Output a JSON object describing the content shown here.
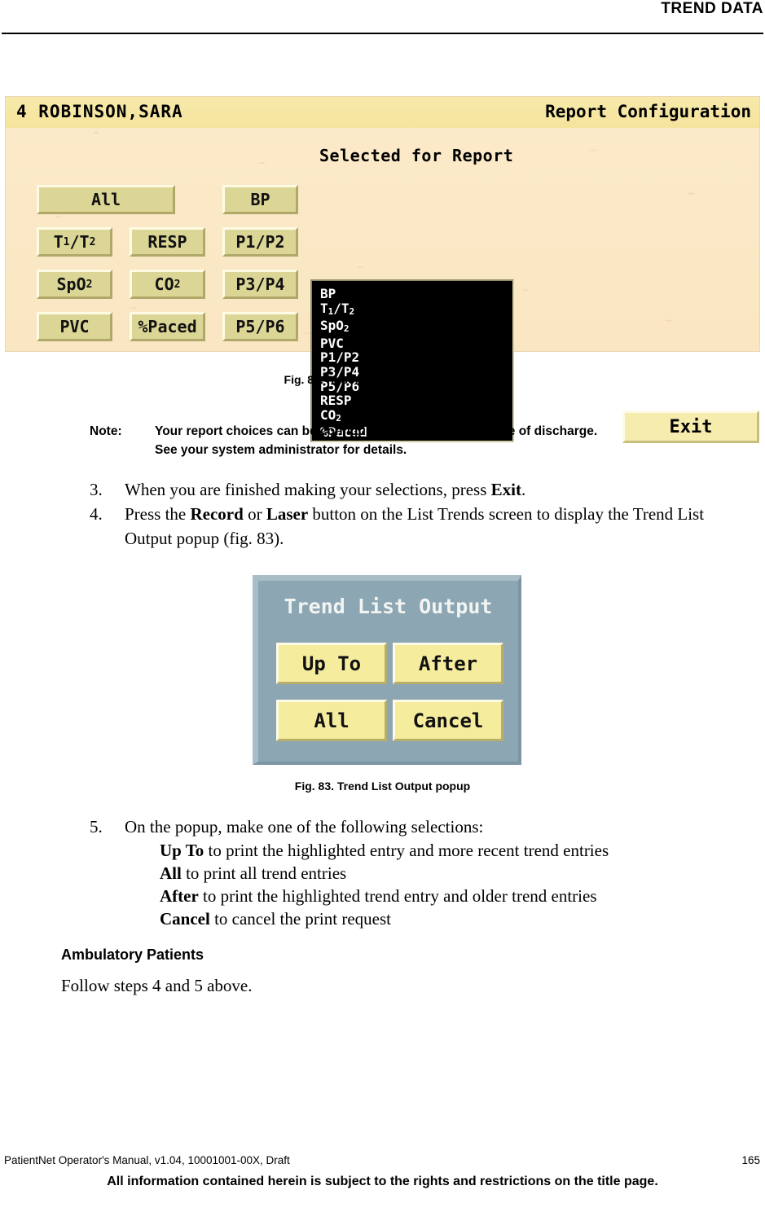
{
  "header": {
    "running_title": "TREND DATA"
  },
  "figure_82": {
    "caption": "Fig. 82. Report Configuration screen",
    "titlebar": {
      "bed_number": "4",
      "patient_name": "ROBINSON,SARA",
      "left_text": "4  ROBINSON,SARA",
      "screen_title": "Report Configuration"
    },
    "selected_label": "Selected for Report",
    "buttons": [
      {
        "label": "All",
        "sub": ""
      },
      {
        "label": "BP",
        "sub": ""
      },
      {
        "label": "T",
        "sub": "1/T2",
        "display": "T1/T2"
      },
      {
        "label": "RESP",
        "sub": ""
      },
      {
        "label": "P1/P2",
        "sub": ""
      },
      {
        "label": "SpO",
        "sub": "2",
        "display": "SpO2"
      },
      {
        "label": "CO",
        "sub": "2",
        "display": "CO2"
      },
      {
        "label": "P3/P4",
        "sub": ""
      },
      {
        "label": "PVC",
        "sub": ""
      },
      {
        "label": "%Paced",
        "sub": ""
      },
      {
        "label": "P5/P6",
        "sub": ""
      }
    ],
    "button_labels": {
      "all": "All",
      "bp": "BP",
      "t1t2_main": "T",
      "t1t2_sub1": "1",
      "t1t2_mid": "/T",
      "t1t2_sub2": "2",
      "resp": "RESP",
      "p1p2": "P1/P2",
      "spo2_main": "SpO",
      "spo2_sub": "2",
      "co2_main": "CO",
      "co2_sub": "2",
      "p3p4": "P3/P4",
      "pvc": "PVC",
      "paced": "%Paced",
      "p5p6": "P5/P6"
    },
    "selected_list": [
      "BP",
      "T1/T2",
      "SpO2",
      "PVC",
      "P1/P2",
      "P3/P4",
      "P5/P6",
      "RESP",
      "CO2",
      "%Paced"
    ],
    "selected_list_parts": [
      {
        "main": "BP",
        "sub": "",
        "tail": ""
      },
      {
        "main": "T",
        "sub": "1",
        "tail": "/T",
        "sub2": "2"
      },
      {
        "main": "SpO",
        "sub": "2",
        "tail": ""
      },
      {
        "main": "PVC",
        "sub": "",
        "tail": ""
      },
      {
        "main": "P1/P2",
        "sub": "",
        "tail": ""
      },
      {
        "main": "P3/P4",
        "sub": "",
        "tail": ""
      },
      {
        "main": "P5/P6",
        "sub": "",
        "tail": ""
      },
      {
        "main": "RESP",
        "sub": "",
        "tail": ""
      },
      {
        "main": "CO",
        "sub": "2",
        "tail": ""
      },
      {
        "main": "%Paced",
        "sub": "",
        "tail": ""
      }
    ],
    "exit_label": "Exit",
    "colors": {
      "background": "#fbe9c6",
      "titlebar": "#f5e49c",
      "button_face": "#dcd696",
      "exit_face": "#f6ecae",
      "listbox": "#000000",
      "listbox_text": "#ffffff"
    }
  },
  "note": {
    "label": "Note:",
    "line1": "Your report choices can be configured to be kept at the time of discharge.",
    "line2": "See your system administrator for details."
  },
  "steps": {
    "step3": {
      "number": "3.",
      "text_before": "When you are finished making your selections, press ",
      "bold1": "Exit",
      "text_after": "."
    },
    "step4": {
      "number": "4.",
      "text_before": "Press the ",
      "bold1": "Record",
      "text_mid": " or ",
      "bold2": "Laser",
      "text_after": " button on the List Trends screen to display the Trend List Output popup (fig. 83)."
    },
    "step5": {
      "number": "5.",
      "text": "On the popup, make one of the following selections:",
      "options": [
        {
          "bold": "Up To",
          "text": " to print the highlighted entry and more recent trend entries"
        },
        {
          "bold": "All",
          "text": " to print all trend entries"
        },
        {
          "bold": "After",
          "text": " to print the highlighted trend entry and older trend entries"
        },
        {
          "bold": "Cancel",
          "text": " to cancel the print request"
        }
      ]
    }
  },
  "figure_83": {
    "caption": "Fig. 83. Trend List Output popup",
    "title": "Trend List Output",
    "buttons": [
      {
        "label": "Up To"
      },
      {
        "label": "After"
      },
      {
        "label": "All"
      },
      {
        "label": "Cancel"
      }
    ],
    "button_labels": {
      "up_to": "Up To",
      "after": "After",
      "all": "All",
      "cancel": "Cancel"
    },
    "colors": {
      "panel": "#8ca6b4",
      "title_text": "#f2f4f2",
      "button_face": "#f5ec9e"
    }
  },
  "section": {
    "heading": "Ambulatory Patients",
    "body": "Follow steps 4 and 5 above."
  },
  "footer": {
    "left": "PatientNet Operator's Manual, v1.04, 10001001-00X, Draft",
    "page_number": "165",
    "disclaimer": "All information contained herein is subject to the rights and restrictions on the title page."
  }
}
